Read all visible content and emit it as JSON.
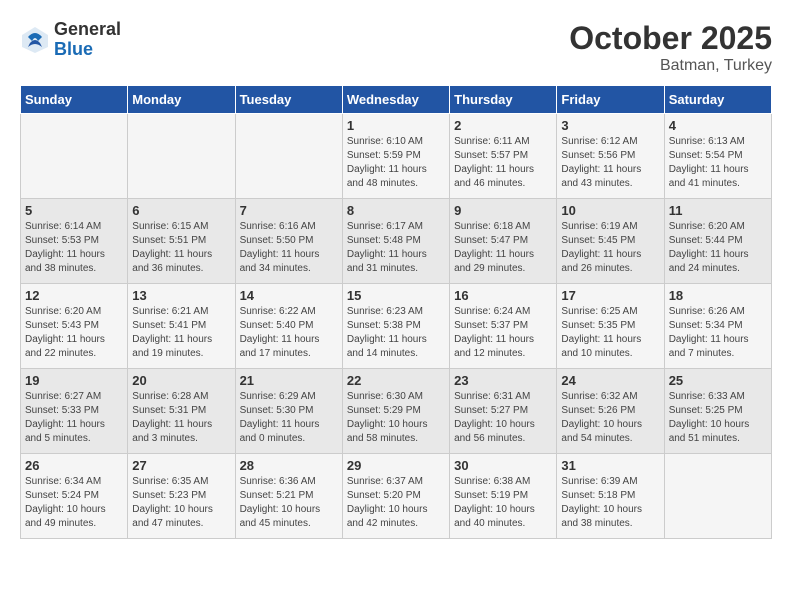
{
  "header": {
    "logo_general": "General",
    "logo_blue": "Blue",
    "month": "October 2025",
    "location": "Batman, Turkey"
  },
  "days_of_week": [
    "Sunday",
    "Monday",
    "Tuesday",
    "Wednesday",
    "Thursday",
    "Friday",
    "Saturday"
  ],
  "weeks": [
    [
      {
        "day": "",
        "info": ""
      },
      {
        "day": "",
        "info": ""
      },
      {
        "day": "",
        "info": ""
      },
      {
        "day": "1",
        "info": "Sunrise: 6:10 AM\nSunset: 5:59 PM\nDaylight: 11 hours\nand 48 minutes."
      },
      {
        "day": "2",
        "info": "Sunrise: 6:11 AM\nSunset: 5:57 PM\nDaylight: 11 hours\nand 46 minutes."
      },
      {
        "day": "3",
        "info": "Sunrise: 6:12 AM\nSunset: 5:56 PM\nDaylight: 11 hours\nand 43 minutes."
      },
      {
        "day": "4",
        "info": "Sunrise: 6:13 AM\nSunset: 5:54 PM\nDaylight: 11 hours\nand 41 minutes."
      }
    ],
    [
      {
        "day": "5",
        "info": "Sunrise: 6:14 AM\nSunset: 5:53 PM\nDaylight: 11 hours\nand 38 minutes."
      },
      {
        "day": "6",
        "info": "Sunrise: 6:15 AM\nSunset: 5:51 PM\nDaylight: 11 hours\nand 36 minutes."
      },
      {
        "day": "7",
        "info": "Sunrise: 6:16 AM\nSunset: 5:50 PM\nDaylight: 11 hours\nand 34 minutes."
      },
      {
        "day": "8",
        "info": "Sunrise: 6:17 AM\nSunset: 5:48 PM\nDaylight: 11 hours\nand 31 minutes."
      },
      {
        "day": "9",
        "info": "Sunrise: 6:18 AM\nSunset: 5:47 PM\nDaylight: 11 hours\nand 29 minutes."
      },
      {
        "day": "10",
        "info": "Sunrise: 6:19 AM\nSunset: 5:45 PM\nDaylight: 11 hours\nand 26 minutes."
      },
      {
        "day": "11",
        "info": "Sunrise: 6:20 AM\nSunset: 5:44 PM\nDaylight: 11 hours\nand 24 minutes."
      }
    ],
    [
      {
        "day": "12",
        "info": "Sunrise: 6:20 AM\nSunset: 5:43 PM\nDaylight: 11 hours\nand 22 minutes."
      },
      {
        "day": "13",
        "info": "Sunrise: 6:21 AM\nSunset: 5:41 PM\nDaylight: 11 hours\nand 19 minutes."
      },
      {
        "day": "14",
        "info": "Sunrise: 6:22 AM\nSunset: 5:40 PM\nDaylight: 11 hours\nand 17 minutes."
      },
      {
        "day": "15",
        "info": "Sunrise: 6:23 AM\nSunset: 5:38 PM\nDaylight: 11 hours\nand 14 minutes."
      },
      {
        "day": "16",
        "info": "Sunrise: 6:24 AM\nSunset: 5:37 PM\nDaylight: 11 hours\nand 12 minutes."
      },
      {
        "day": "17",
        "info": "Sunrise: 6:25 AM\nSunset: 5:35 PM\nDaylight: 11 hours\nand 10 minutes."
      },
      {
        "day": "18",
        "info": "Sunrise: 6:26 AM\nSunset: 5:34 PM\nDaylight: 11 hours\nand 7 minutes."
      }
    ],
    [
      {
        "day": "19",
        "info": "Sunrise: 6:27 AM\nSunset: 5:33 PM\nDaylight: 11 hours\nand 5 minutes."
      },
      {
        "day": "20",
        "info": "Sunrise: 6:28 AM\nSunset: 5:31 PM\nDaylight: 11 hours\nand 3 minutes."
      },
      {
        "day": "21",
        "info": "Sunrise: 6:29 AM\nSunset: 5:30 PM\nDaylight: 11 hours\nand 0 minutes."
      },
      {
        "day": "22",
        "info": "Sunrise: 6:30 AM\nSunset: 5:29 PM\nDaylight: 10 hours\nand 58 minutes."
      },
      {
        "day": "23",
        "info": "Sunrise: 6:31 AM\nSunset: 5:27 PM\nDaylight: 10 hours\nand 56 minutes."
      },
      {
        "day": "24",
        "info": "Sunrise: 6:32 AM\nSunset: 5:26 PM\nDaylight: 10 hours\nand 54 minutes."
      },
      {
        "day": "25",
        "info": "Sunrise: 6:33 AM\nSunset: 5:25 PM\nDaylight: 10 hours\nand 51 minutes."
      }
    ],
    [
      {
        "day": "26",
        "info": "Sunrise: 6:34 AM\nSunset: 5:24 PM\nDaylight: 10 hours\nand 49 minutes."
      },
      {
        "day": "27",
        "info": "Sunrise: 6:35 AM\nSunset: 5:23 PM\nDaylight: 10 hours\nand 47 minutes."
      },
      {
        "day": "28",
        "info": "Sunrise: 6:36 AM\nSunset: 5:21 PM\nDaylight: 10 hours\nand 45 minutes."
      },
      {
        "day": "29",
        "info": "Sunrise: 6:37 AM\nSunset: 5:20 PM\nDaylight: 10 hours\nand 42 minutes."
      },
      {
        "day": "30",
        "info": "Sunrise: 6:38 AM\nSunset: 5:19 PM\nDaylight: 10 hours\nand 40 minutes."
      },
      {
        "day": "31",
        "info": "Sunrise: 6:39 AM\nSunset: 5:18 PM\nDaylight: 10 hours\nand 38 minutes."
      },
      {
        "day": "",
        "info": ""
      }
    ]
  ]
}
